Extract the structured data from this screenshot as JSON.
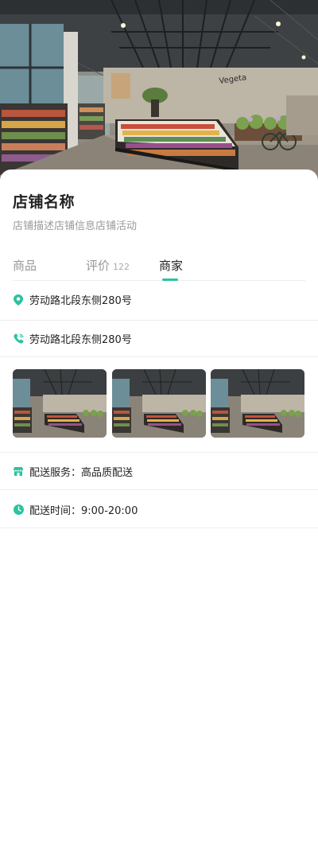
{
  "store": {
    "name": "店铺名称",
    "description": "店铺描述店铺信息店铺活动"
  },
  "tabs": [
    {
      "label": "商品",
      "count": ""
    },
    {
      "label": "评价",
      "count": "122"
    },
    {
      "label": "商家",
      "count": ""
    }
  ],
  "active_tab": "商家",
  "info": {
    "address": "劳动路北段东侧280号",
    "phone": "劳动路北段东侧280号",
    "delivery_service": "配送服务：高品质配送",
    "delivery_hours": "配送时间：9:00-20:00"
  },
  "gallery": {
    "count": 3
  },
  "colors": {
    "accent": "#2bc3a0",
    "text_primary": "#222222",
    "text_secondary": "#9a9a9a",
    "divider": "#eeeeee"
  },
  "icons": {
    "address": "location-pin-icon",
    "phone": "phone-icon",
    "delivery": "shop-icon",
    "hours": "clock-icon"
  }
}
